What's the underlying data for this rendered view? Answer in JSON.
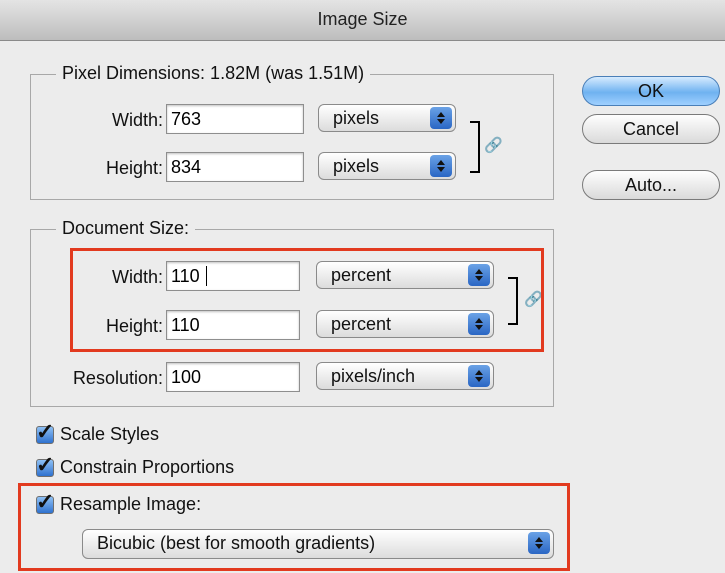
{
  "window": {
    "title": "Image Size"
  },
  "pixel_dimensions": {
    "legend": "Pixel Dimensions:  1.82M (was 1.51M)",
    "width_label": "Width:",
    "width_value": "763",
    "width_unit": "pixels",
    "height_label": "Height:",
    "height_value": "834",
    "height_unit": "pixels"
  },
  "document_size": {
    "legend": "Document Size:",
    "width_label": "Width:",
    "width_value": "110",
    "width_unit": "percent",
    "height_label": "Height:",
    "height_value": "110",
    "height_unit": "percent",
    "resolution_label": "Resolution:",
    "resolution_value": "100",
    "resolution_unit": "pixels/inch"
  },
  "buttons": {
    "ok": "OK",
    "cancel": "Cancel",
    "auto": "Auto..."
  },
  "options": {
    "scale_styles": {
      "label": "Scale Styles",
      "checked": true
    },
    "constrain_proportions": {
      "label": "Constrain Proportions",
      "checked": true
    },
    "resample_image": {
      "label": "Resample Image:",
      "checked": true
    },
    "resample_method": "Bicubic (best for smooth gradients)"
  },
  "colors": {
    "highlight": "#e23a1f",
    "accent": "#2f72cf"
  },
  "icons": {
    "link": "link-icon",
    "popup": "popup-arrows-icon",
    "check": "checkmark-icon"
  }
}
